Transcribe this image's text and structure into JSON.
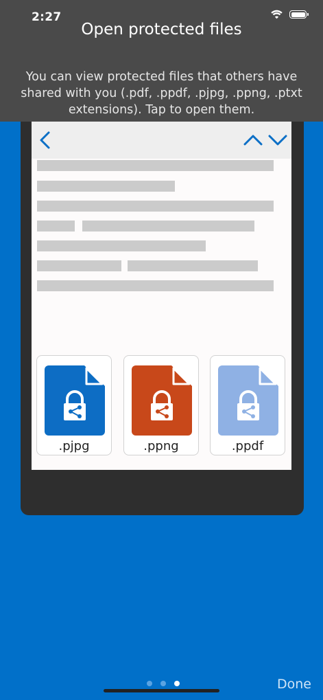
{
  "status_bar": {
    "time": "2:27"
  },
  "header": {
    "title": "Open protected files",
    "description": "You can view protected files that others have shared with you (.pdf, .ppdf, .pjpg, .ppng, .ptxt extensions). Tap to open them."
  },
  "files": [
    {
      "extension": ".pjpg",
      "color": "#0d6dc4"
    },
    {
      "extension": ".ppng",
      "color": "#c8481a"
    },
    {
      "extension": ".ppdf",
      "color": "#8fb1e4"
    }
  ],
  "pager": {
    "total": 3,
    "current": 3
  },
  "footer": {
    "done_label": "Done"
  },
  "colors": {
    "background": "#0170c9",
    "panel": "#4a4a4a",
    "accent": "#0b6fc6"
  }
}
